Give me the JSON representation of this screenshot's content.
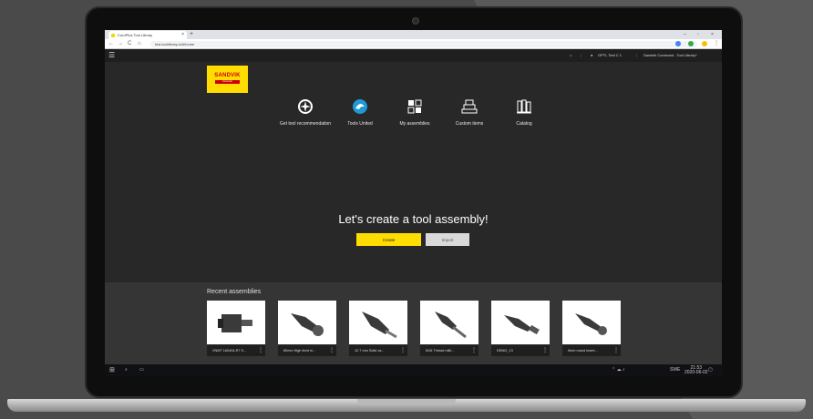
{
  "browser": {
    "tab_title": "CoroPlus Tool Library",
    "tab_close": "×",
    "new_tab": "+",
    "window_controls": [
      "–",
      "▫",
      "×"
    ],
    "nav_back": "←",
    "nav_forward": "→",
    "nav_reload": "C",
    "nav_home": "⌂",
    "url": "test.toollibrary.io/#/home"
  },
  "app_header": {
    "menu_icon": "☰",
    "user": "OPTL Test C 1",
    "company": "Sandvik Coromant - Tool Library*"
  },
  "logo": {
    "brand": "SANDVIK",
    "sub": "Coromant"
  },
  "nav_items": [
    {
      "label": "Get tool recommendation",
      "icon": "compass-icon"
    },
    {
      "label": "Tools United",
      "icon": "tools-united-icon"
    },
    {
      "label": "My assemblies",
      "icon": "assemblies-icon"
    },
    {
      "label": "Custom items",
      "icon": "custom-items-icon"
    },
    {
      "label": "Catalog",
      "icon": "catalog-icon"
    }
  ],
  "hero": {
    "title": "Let's create a tool assembly!",
    "create_label": "Create",
    "import_label": "Import"
  },
  "recent": {
    "title": "Recent assemblies",
    "items": [
      {
        "label": "VNMT 160404-R7 5...",
        "icon": "holder-icon"
      },
      {
        "label": "80mm High feed m...",
        "icon": "milling-cutter-icon"
      },
      {
        "label": "12.7 mm Solid ca...",
        "icon": "solid-carbide-icon"
      },
      {
        "label": "M16 Thread milli...",
        "icon": "thread-mill-icon"
      },
      {
        "label": "DEMO_13",
        "icon": "demo-tool-icon"
      },
      {
        "label": "9mm round insert...",
        "icon": "round-insert-icon"
      }
    ]
  },
  "taskbar": {
    "time": "21:53",
    "date": "2020-06-02",
    "lang": "SWE"
  },
  "colors": {
    "accent": "#ffdd00",
    "background": "#282828",
    "recent_background": "#353535"
  }
}
